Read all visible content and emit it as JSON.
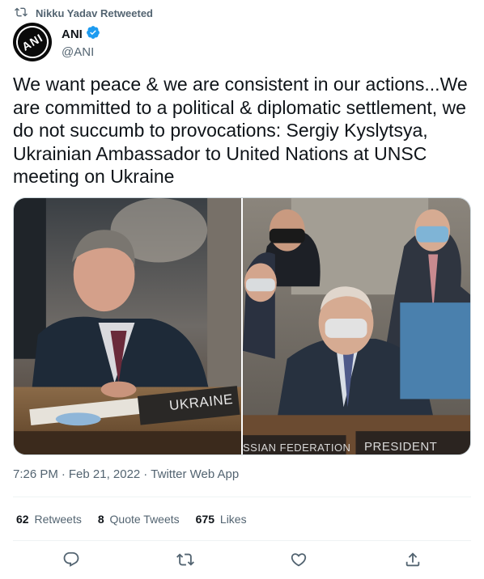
{
  "retweet": {
    "text": "Nikku Yadav Retweeted",
    "icon": "retweet-icon"
  },
  "author": {
    "name": "ANI",
    "handle": "@ANI",
    "avatar_text": "ANI",
    "verified_icon": "verified-badge-icon",
    "verified_color": "#1d9bf0"
  },
  "tweet": {
    "text": "We want peace & we are consistent in our actions...We are committed to a political & diplomatic settlement, we do not succumb to provocations: Sergiy Kyslytsya, Ukrainian Ambassador to United Nations at UNSC meeting on Ukraine"
  },
  "media": {
    "photo1": {
      "placard": "UKRAINE"
    },
    "photo2": {
      "placard_left": "SSIAN FEDERATION",
      "placard_right": "PRESIDENT"
    }
  },
  "meta": {
    "time": "7:26 PM",
    "separator": "·",
    "date": "Feb 21, 2022",
    "source": "Twitter Web App"
  },
  "stats": {
    "retweets_count": "62",
    "retweets_label": "Retweets",
    "quotes_count": "8",
    "quotes_label": "Quote Tweets",
    "likes_count": "675",
    "likes_label": "Likes"
  },
  "actions": [
    "reply-icon",
    "retweet-icon",
    "like-icon",
    "share-icon"
  ],
  "colors": {
    "secondary_text": "#536471",
    "primary_text": "#0f1419",
    "divider": "#eff3f4",
    "accent": "#1d9bf0"
  }
}
